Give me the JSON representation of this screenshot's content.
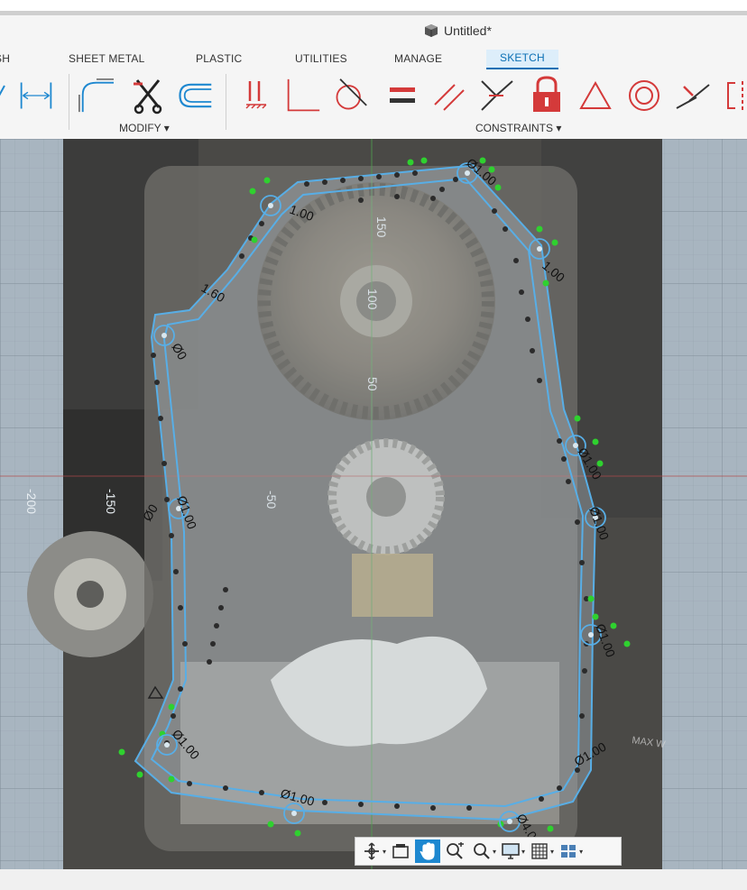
{
  "window": {
    "title": "Untitled*"
  },
  "tabs": [
    {
      "label": "SH"
    },
    {
      "label": "SHEET METAL"
    },
    {
      "label": "PLASTIC"
    },
    {
      "label": "UTILITIES"
    },
    {
      "label": "MANAGE"
    },
    {
      "label": "SKETCH",
      "active": true
    }
  ],
  "groups": {
    "modify": "MODIFY ▾",
    "constraints": "CONSTRAINTS ▾"
  },
  "ribbon_tools": [
    "triangle-icon",
    "dimension-icon",
    "fillet-icon",
    "trim-icon",
    "offset-icon",
    "coincident-icon",
    "perpendicular-icon",
    "tangent-icon",
    "equal-icon",
    "parallel-icon",
    "midpoint-icon",
    "fix-icon",
    "triangle-constraint-icon",
    "concentric-icon",
    "collinear-icon",
    "symmetry-icon"
  ],
  "canvas": {
    "axis_labels": {
      "y150": "150",
      "y100": "100",
      "y50": "50",
      "x_minus50": "-50",
      "x_minus150": "-150",
      "x_minus200": "-200"
    },
    "dims": {
      "d1": "1.00",
      "d2": "1.00",
      "d3": "1.60",
      "d4": "Ø0",
      "d5": "Ø1.00",
      "d6": "Ø0",
      "d7": "Ø1.00",
      "d8": "Ø1.00",
      "d9": "Ø1.00",
      "d10": "Ø4.00",
      "d11": "Ø1.00",
      "d12": "Ø1.00",
      "d13": "Ø1.00",
      "d14": "Ø1.00"
    },
    "background_text": "MAX W"
  },
  "navbar": [
    "orbit-icon",
    "look-at-icon",
    "pan-icon",
    "zoom-icon",
    "fit-icon",
    "display-settings-icon",
    "grid-settings-icon",
    "viewports-icon"
  ],
  "colors": {
    "accent": "#0a6fb4",
    "constraint_red": "#d43a3a",
    "sketch_blue": "#4da6e0",
    "point_green": "#2fd12f"
  }
}
